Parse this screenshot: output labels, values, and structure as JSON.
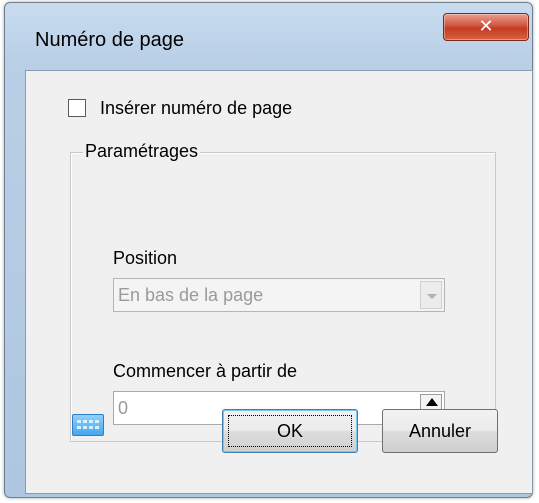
{
  "window": {
    "title": "Numéro de page",
    "close_icon": "close-icon"
  },
  "insert_checkbox": {
    "label": "Insérer numéro de page",
    "checked": false
  },
  "settings_group": {
    "legend": "Paramétrages",
    "position": {
      "label": "Position",
      "value": "En bas de la page",
      "enabled": false
    },
    "start_from": {
      "label": "Commencer à partir de",
      "value": "0",
      "enabled": false
    }
  },
  "footer": {
    "keyboard_icon": "keyboard-icon",
    "ok_label": "OK",
    "cancel_label": "Annuler"
  },
  "colors": {
    "frame": "#b9cfe6",
    "close_button": "#c43a22",
    "client": "#f0f0f0"
  }
}
